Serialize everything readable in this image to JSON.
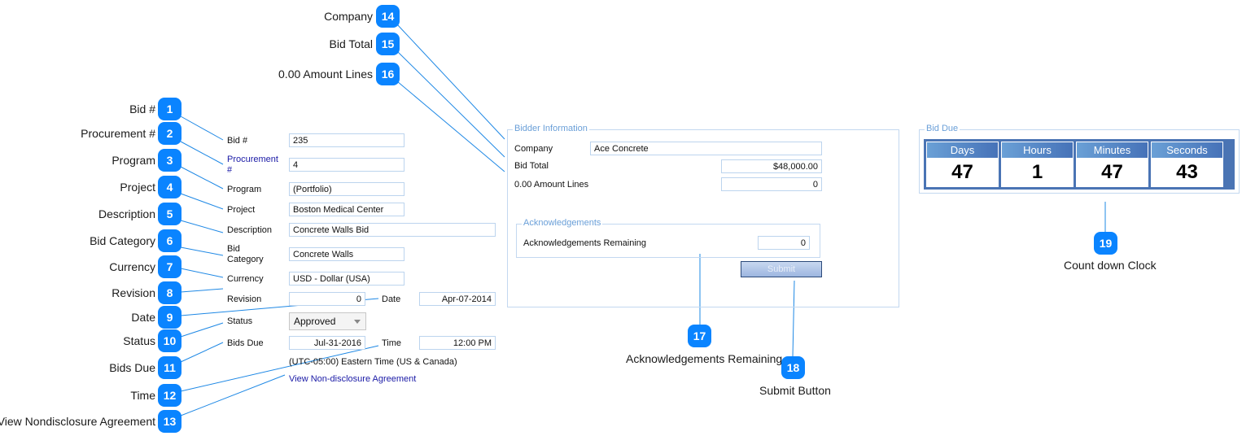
{
  "callouts": [
    {
      "num": "1",
      "label": "Bid #"
    },
    {
      "num": "2",
      "label": "Procurement #"
    },
    {
      "num": "3",
      "label": "Program"
    },
    {
      "num": "4",
      "label": "Project"
    },
    {
      "num": "5",
      "label": "Description"
    },
    {
      "num": "6",
      "label": "Bid Category"
    },
    {
      "num": "7",
      "label": "Currency"
    },
    {
      "num": "8",
      "label": "Revision"
    },
    {
      "num": "9",
      "label": "Date"
    },
    {
      "num": "10",
      "label": "Status"
    },
    {
      "num": "11",
      "label": "Bids Due"
    },
    {
      "num": "12",
      "label": "Time"
    },
    {
      "num": "13",
      "label": "View Nondisclosure Agreement"
    },
    {
      "num": "14",
      "label": "Company"
    },
    {
      "num": "15",
      "label": "Bid Total"
    },
    {
      "num": "16",
      "label": "0.00 Amount Lines"
    },
    {
      "num": "17",
      "label": "Acknowledgements Remaining"
    },
    {
      "num": "18",
      "label": "Submit Button"
    },
    {
      "num": "19",
      "label": "Count down Clock"
    }
  ],
  "form": {
    "bid_no": {
      "label": "Bid #",
      "value": "235"
    },
    "procurement_no": {
      "label_line1": "Procurement",
      "label_line2": "#",
      "value": "4"
    },
    "program": {
      "label": "Program",
      "value": "(Portfolio)"
    },
    "project": {
      "label": "Project",
      "value": "Boston Medical Center"
    },
    "description": {
      "label": "Description",
      "value": "Concrete Walls Bid"
    },
    "bid_category": {
      "label_line1": "Bid",
      "label_line2": "Category",
      "value": "Concrete Walls"
    },
    "currency": {
      "label": "Currency",
      "value": "USD - Dollar (USA)"
    },
    "revision": {
      "label": "Revision",
      "value": "0"
    },
    "date": {
      "label": "Date",
      "value": "Apr-07-2014"
    },
    "status": {
      "label": "Status",
      "value": "Approved"
    },
    "bids_due": {
      "label": "Bids Due",
      "value": "Jul-31-2016"
    },
    "time": {
      "label": "Time",
      "value": "12:00 PM"
    },
    "timezone": "(UTC-05:00) Eastern Time (US & Canada)",
    "nda_link": "View Non-disclosure Agreement"
  },
  "bidder": {
    "legend": "Bidder Information",
    "company": {
      "label": "Company",
      "value": "Ace Concrete"
    },
    "bid_total": {
      "label": "Bid Total",
      "value": "$48,000.00"
    },
    "amount_lines": {
      "label": "0.00 Amount Lines",
      "value": "0"
    },
    "acknowledgements": {
      "legend": "Acknowledgements",
      "label": "Acknowledgements Remaining",
      "value": "0"
    },
    "submit_label": "Submit"
  },
  "bid_due": {
    "legend": "Bid Due",
    "units": [
      {
        "label": "Days",
        "value": "47"
      },
      {
        "label": "Hours",
        "value": "1"
      },
      {
        "label": "Minutes",
        "value": "47"
      },
      {
        "label": "Seconds",
        "value": "43"
      }
    ]
  },
  "colors": {
    "badge": "#0a84ff",
    "connector": "#1e88e5",
    "link": "#1a1aa6",
    "groupbox_legend": "#6a9fd8",
    "clock_frame": "#4a74b4"
  }
}
